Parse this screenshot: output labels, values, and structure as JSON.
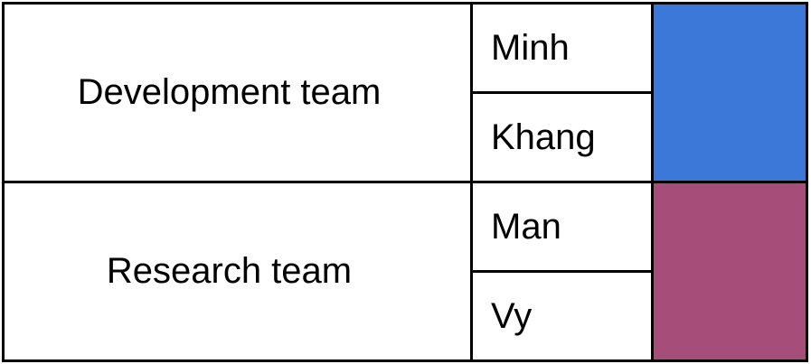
{
  "teams": [
    {
      "name": "Development team",
      "members": [
        "Minh",
        "Khang"
      ],
      "color": "#3c78d8"
    },
    {
      "name": "Research team",
      "members": [
        "Man",
        "Vy"
      ],
      "color": "#a64d79"
    }
  ]
}
